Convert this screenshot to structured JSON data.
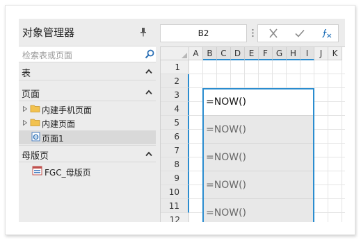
{
  "panel": {
    "title": "对象管理器",
    "search_placeholder": "检索表或页面",
    "sections": [
      {
        "label": "表"
      },
      {
        "label": "页面"
      },
      {
        "label": "母版页"
      }
    ],
    "pages": [
      {
        "label": "内建手机页面",
        "icon": "folder-icon"
      },
      {
        "label": "内建页面",
        "icon": "folder-icon"
      },
      {
        "label": "页面1",
        "icon": "page-icon"
      }
    ],
    "masters": [
      {
        "label": "FGC_母版页",
        "icon": "master-page-icon"
      }
    ]
  },
  "formula_bar": {
    "cell_ref": "B2"
  },
  "grid": {
    "columns": [
      "A",
      "B",
      "C",
      "D",
      "E",
      "F",
      "G",
      "H",
      "I",
      "J",
      "K"
    ],
    "rows": [
      "1",
      "2",
      "3",
      "4",
      "5",
      "6",
      "7",
      "8",
      "9",
      "10",
      "11",
      "12"
    ],
    "cells": [
      {
        "value": "=NOW()"
      },
      {
        "value": "=NOW()"
      },
      {
        "value": "=NOW()"
      },
      {
        "value": "=NOW()"
      },
      {
        "value": "=NOW()"
      }
    ]
  },
  "colors": {
    "accent": "#2a8ccf",
    "folder": "#f2c24f"
  }
}
